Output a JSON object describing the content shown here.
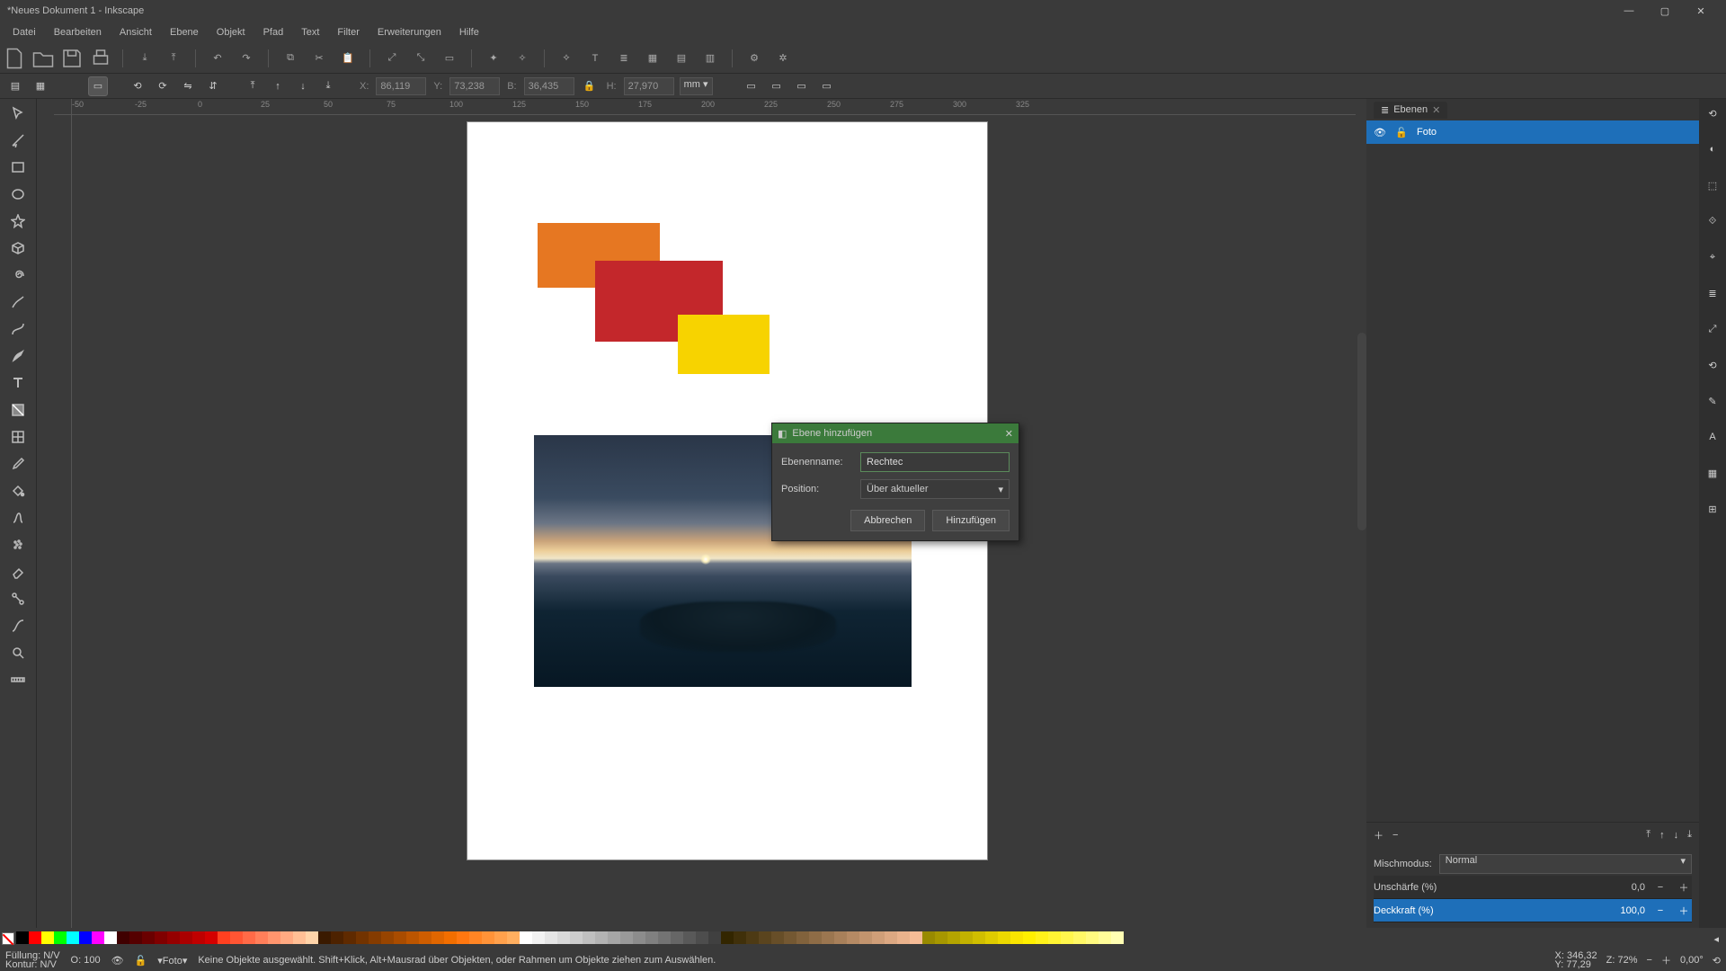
{
  "window": {
    "title": "*Neues Dokument 1 - Inkscape"
  },
  "menu": [
    "Datei",
    "Bearbeiten",
    "Ansicht",
    "Ebene",
    "Objekt",
    "Pfad",
    "Text",
    "Filter",
    "Erweiterungen",
    "Hilfe"
  ],
  "options": {
    "x_label": "X:",
    "x": "86,119",
    "y_label": "Y:",
    "y": "73,238",
    "w_label": "B:",
    "w": "36,435",
    "h_label": "H:",
    "h": "27,970",
    "unit": "mm"
  },
  "ruler_ticks": [
    "-50",
    "-25",
    "0",
    "25",
    "50",
    "75",
    "100",
    "125",
    "150",
    "175",
    "200",
    "225",
    "250",
    "275",
    "300",
    "325"
  ],
  "dialog": {
    "title": "Ebene hinzufügen",
    "name_label": "Ebenenname:",
    "name_value": "Rechtec",
    "position_label": "Position:",
    "position_value": "Über aktueller",
    "cancel": "Abbrechen",
    "add": "Hinzufügen"
  },
  "layers": {
    "tab": "Ebenen",
    "items": [
      {
        "name": "Foto"
      }
    ],
    "blend_label": "Mischmodus:",
    "blend_value": "Normal",
    "blur_label": "Unschärfe (%)",
    "blur_value": "0,0",
    "opacity_label": "Deckkraft (%)",
    "opacity_value": "100,0"
  },
  "status": {
    "fill_label": "Füllung:",
    "fill_value": "N/V",
    "stroke_label": "Kontur:",
    "stroke_value": "N/V",
    "o_label": "O:",
    "o_value": "100",
    "layer": "Foto",
    "hint": "Keine Objekte ausgewählt. Shift+Klick, Alt+Mausrad über Objekten, oder Rahmen um Objekte ziehen zum Auswählen.",
    "coord_x_label": "X:",
    "coord_x": "346,32",
    "coord_y_label": "Y:",
    "coord_y": "77,29",
    "zoom_label": "Z:",
    "zoom": "72%",
    "rotate": "0,00°"
  },
  "swatches": {
    "row1": [
      "#000000",
      "#ff0000",
      "#ffff00",
      "#00ff00",
      "#00ffff",
      "#0000ff",
      "#ff00ff",
      "#ffffff",
      "#400000",
      "#550000",
      "#6a0000",
      "#800000",
      "#950000",
      "#aa0000",
      "#bf0000",
      "#d40000",
      "#ff4020",
      "#ff5533",
      "#ff6a47",
      "#ff7f5a",
      "#ff956e",
      "#ffaa82",
      "#ffbf95",
      "#ffd4a9",
      "#3a1a00",
      "#4d2200",
      "#5f2a00",
      "#723300",
      "#843b00",
      "#974400",
      "#a94c00",
      "#bc5500",
      "#ce5d00",
      "#e06600",
      "#f26e00",
      "#ff7710",
      "#ff8524",
      "#ff9338",
      "#ffa14c",
      "#ffaf60",
      "#ffffff",
      "#f2f2f2",
      "#e5e5e5",
      "#d9d9d9",
      "#cccccc",
      "#bfbfbf",
      "#b3b3b3",
      "#a6a6a6",
      "#999999",
      "#8c8c8c",
      "#808080",
      "#737373",
      "#666666",
      "#595959",
      "#4d4d4d",
      "#404040",
      "#332600",
      "#40300a",
      "#4d3a14",
      "#5a441e",
      "#674e28",
      "#745832",
      "#81623c",
      "#8e6c46",
      "#9b7650",
      "#a8805a",
      "#b58a64",
      "#c2946e",
      "#cf9e78",
      "#dca882",
      "#e9b28c",
      "#f6bc96",
      "#988a00",
      "#a69700",
      "#b4a400",
      "#c2b100",
      "#d0be00",
      "#decb00",
      "#ecd800",
      "#fae500",
      "#fff000",
      "#fff21a",
      "#fff433",
      "#fff64d",
      "#fff866",
      "#fffa80",
      "#fffc99",
      "#fffeb3"
    ]
  }
}
